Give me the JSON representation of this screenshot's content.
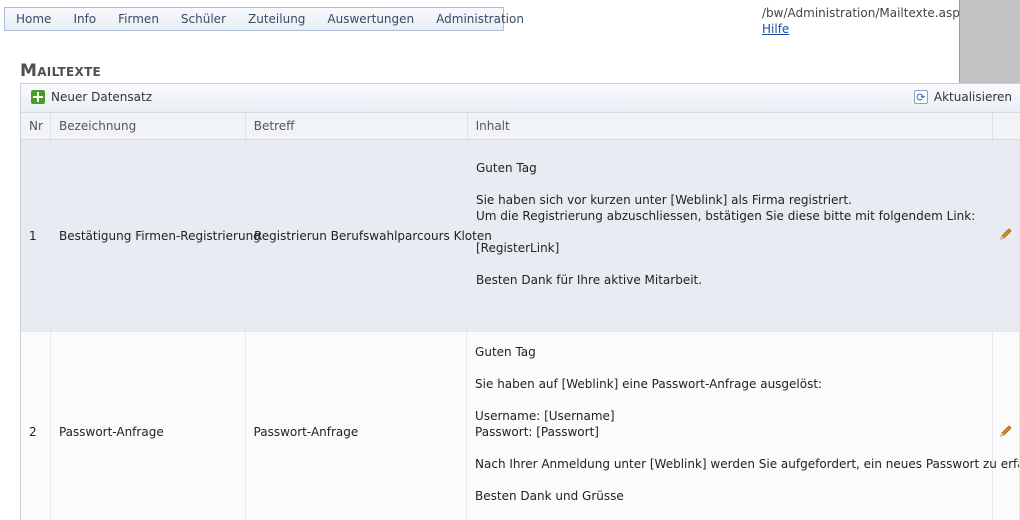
{
  "nav": {
    "items": [
      "Home",
      "Info",
      "Firmen",
      "Schüler",
      "Zuteilung",
      "Auswertungen",
      "Administration"
    ]
  },
  "header": {
    "path": "/bw/Administration/Mailtexte.aspx",
    "help_link": "Hilfe"
  },
  "page_title": "Mailtexte",
  "toolbar": {
    "new_record": "Neuer Datensatz",
    "refresh": "Aktualisieren"
  },
  "grid": {
    "columns": [
      "Nr",
      "Bezeichnung",
      "Betreff",
      "Inhalt"
    ],
    "rows": [
      {
        "nr": "1",
        "bezeichnung": "Bestätigung Firmen-Registrierung",
        "betreff": "Registrierun Berufswahlparcours Kloten",
        "inhalt": {
          "p1": "Guten Tag",
          "p2_l1": "Sie haben sich vor kurzen unter [Weblink] als Firma registriert.",
          "p2_l2": "Um die Registrierung abzuschliessen, bstätigen Sie diese bitte mit folgendem Link:",
          "p3": "[RegisterLink]",
          "p4": "Besten Dank für Ihre aktive Mitarbeit."
        }
      },
      {
        "nr": "2",
        "bezeichnung": "Passwort-Anfrage",
        "betreff": "Passwort-Anfrage",
        "inhalt": {
          "p1": "Guten Tag",
          "p2": "Sie haben auf [Weblink] eine Passwort-Anfrage ausgelöst:",
          "p3_l1": "Username: [Username]",
          "p3_l2": "Passwort: [Passwort]",
          "p4": "Nach Ihrer Anmeldung unter [Weblink] werden Sie aufgefordert, ein neues Passwort zu erfassen.",
          "p5": "Besten Dank und Grüsse"
        }
      }
    ]
  },
  "icons": {
    "add": "plus-icon",
    "refresh": "refresh-icon",
    "edit": "pencil-icon"
  },
  "colors": {
    "accent_link": "#1a4fa0",
    "row_selected": "#e8ecf2",
    "add_icon": "#4c9a2a",
    "pencil": "#e08a1e"
  }
}
